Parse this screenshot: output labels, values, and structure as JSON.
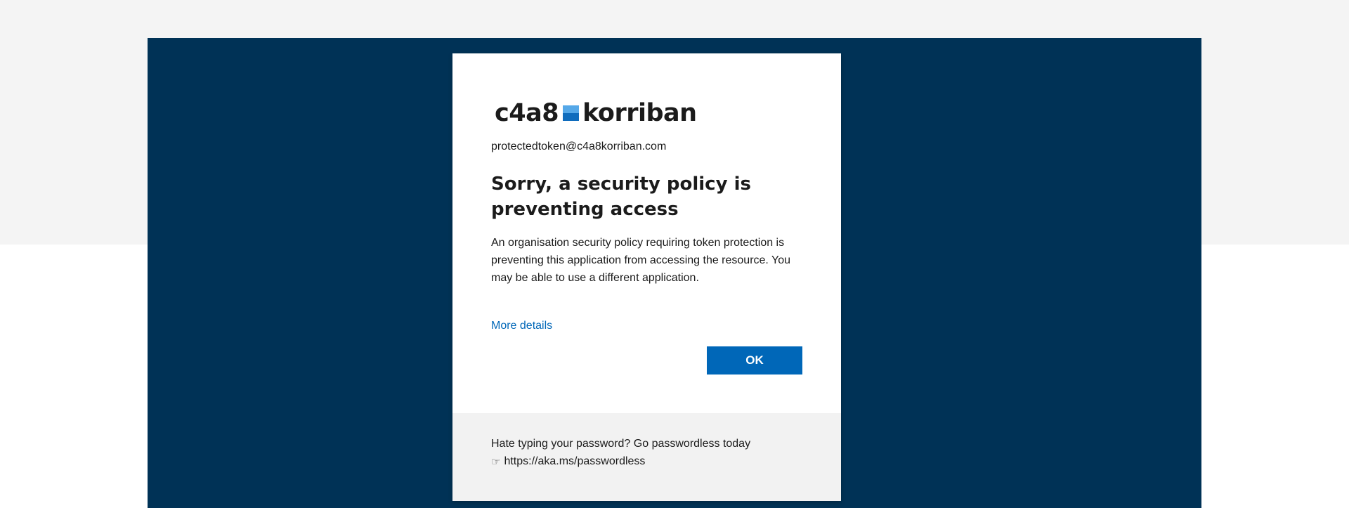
{
  "brand": {
    "name_left": "c4a8",
    "name_right": "korriban"
  },
  "account": {
    "email": "protectedtoken@c4a8korriban.com"
  },
  "message": {
    "title": "Sorry, a security policy is preventing access",
    "body": "An organisation security policy requiring token protection is preventing this application from accessing the resource. You may be able to use a different application.",
    "details_link": "More details"
  },
  "actions": {
    "ok_label": "OK"
  },
  "footer": {
    "line1": "Hate typing your password? Go passwordless today",
    "link_icon": "pointing-hand-icon",
    "link_text": "https://aka.ms/passwordless"
  },
  "colors": {
    "backdrop": "#003256",
    "accent": "#0067b8",
    "logo_light": "#55a8e8",
    "logo_dark": "#0f6cbd"
  }
}
